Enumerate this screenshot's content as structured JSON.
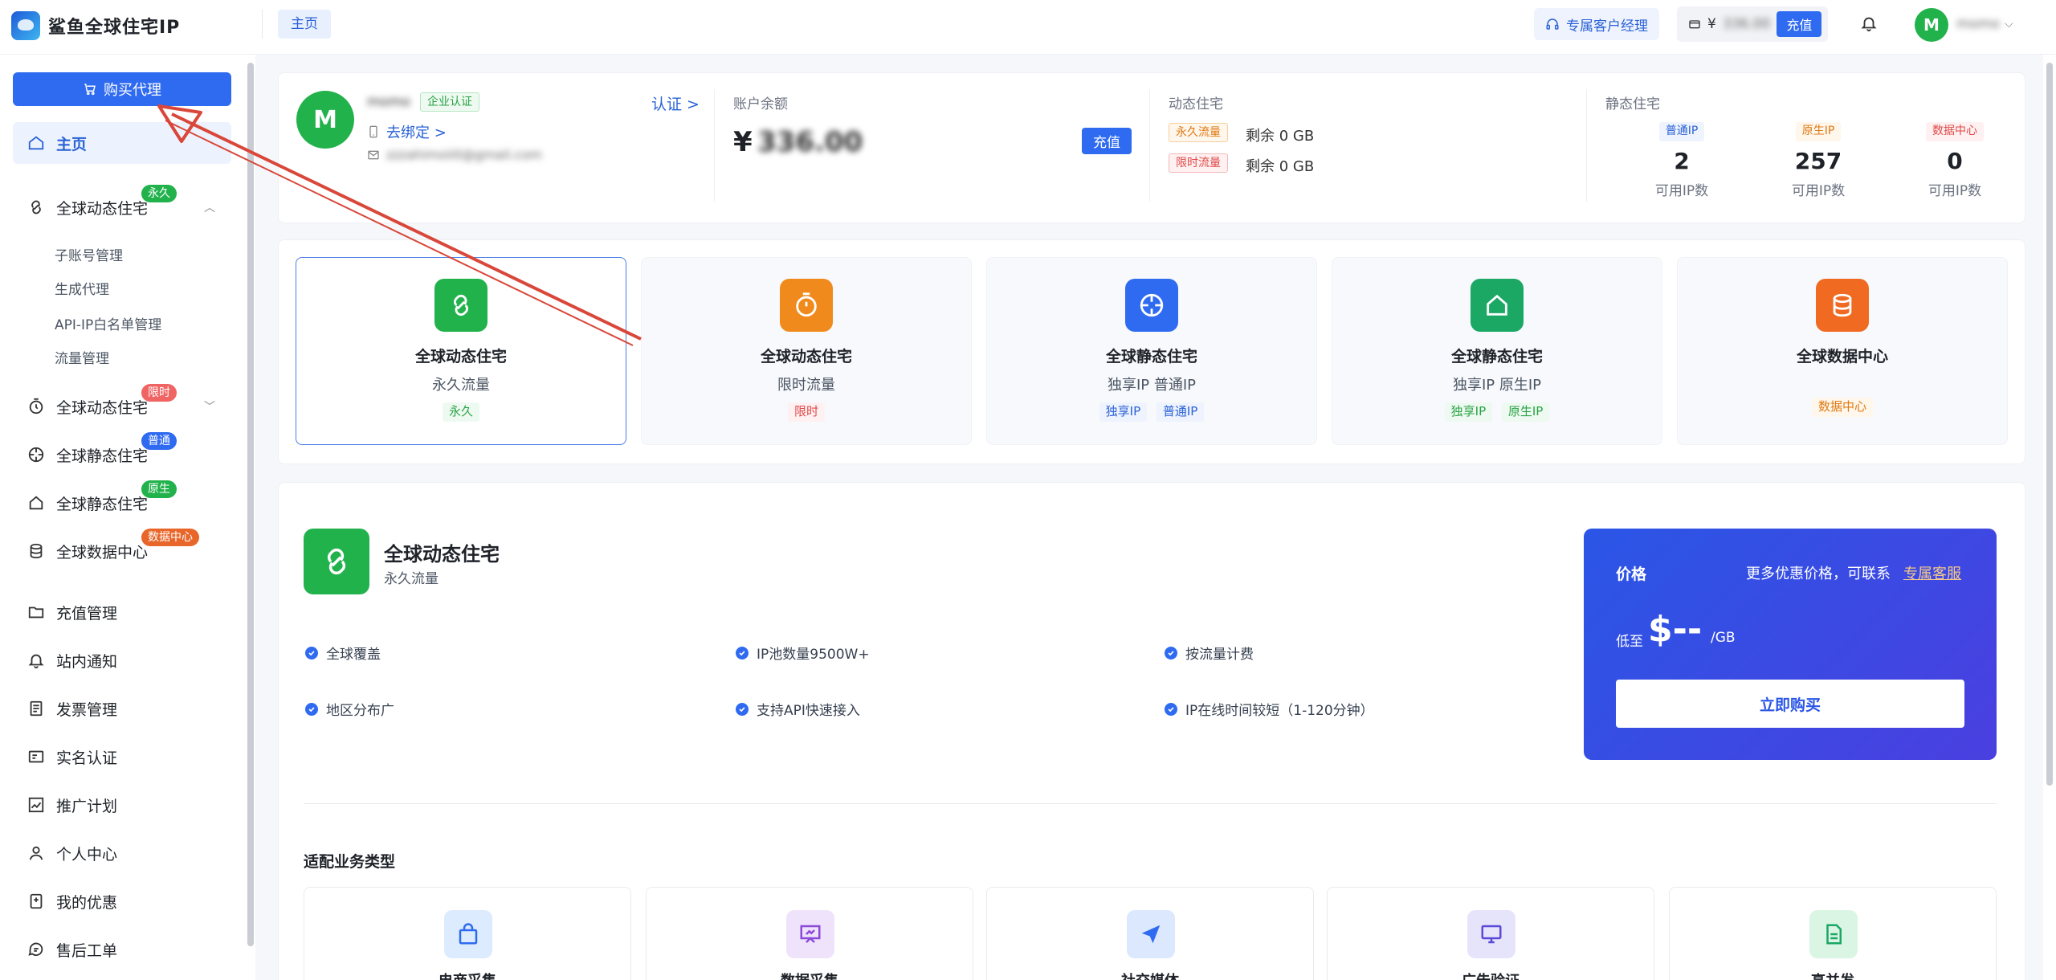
{
  "app": {
    "title": "鲨鱼全球住宅IP"
  },
  "topbar": {
    "tab_home": "主页",
    "manager_label": "专属客户经理",
    "currency": "¥",
    "balance_masked": "336.00",
    "recharge_label": "充值",
    "avatar_letter": "M",
    "user_name": "momo"
  },
  "sidebar": {
    "buy_label": "购买代理",
    "items": [
      {
        "label": "主页"
      },
      {
        "label": "全球动态住宅",
        "badge": "永久"
      },
      {
        "label": "子账号管理"
      },
      {
        "label": "生成代理"
      },
      {
        "label": "API-IP白名单管理"
      },
      {
        "label": "流量管理"
      },
      {
        "label": "全球动态住宅",
        "badge": "限时"
      },
      {
        "label": "全球静态住宅",
        "badge": "普通"
      },
      {
        "label": "全球静态住宅",
        "badge": "原生"
      },
      {
        "label": "全球数据中心",
        "badge": "数据中心"
      },
      {
        "label": "充值管理"
      },
      {
        "label": "站内通知"
      },
      {
        "label": "发票管理"
      },
      {
        "label": "实名认证"
      },
      {
        "label": "推广计划"
      },
      {
        "label": "个人中心"
      },
      {
        "label": "我的优惠"
      },
      {
        "label": "售后工单"
      }
    ]
  },
  "account": {
    "avatar_letter": "M",
    "name_masked": "momo",
    "enterprise_tag": "企业认证",
    "bind_label": "去绑定 >",
    "email_masked": "zzzahimoii0@gmail.com",
    "verify_label": "认证 >",
    "balance_label": "账户余额",
    "currency": "¥",
    "balance_masked": "336.00",
    "recharge_label": "充值",
    "dynamic_title": "动态住宅",
    "dynamic_rows": [
      {
        "tag": "永久流量",
        "text": "剩余 0 GB"
      },
      {
        "tag": "限时流量",
        "text": "剩余 0 GB"
      }
    ],
    "static_title": "静态住宅",
    "static_stats": [
      {
        "tag": "普通IP",
        "value": "2",
        "caption": "可用IP数"
      },
      {
        "tag": "原生IP",
        "value": "257",
        "caption": "可用IP数"
      },
      {
        "tag": "数据中心",
        "value": "0",
        "caption": "可用IP数"
      }
    ]
  },
  "products": [
    {
      "title": "全球动态住宅",
      "subtitle": "永久流量",
      "tags": [
        "永久"
      ]
    },
    {
      "title": "全球动态住宅",
      "subtitle": "限时流量",
      "tags": [
        "限时"
      ]
    },
    {
      "title": "全球静态住宅",
      "subtitle": "独享IP 普通IP",
      "tags": [
        "独享IP",
        "普通IP"
      ]
    },
    {
      "title": "全球静态住宅",
      "subtitle": "独享IP 原生IP",
      "tags": [
        "独享IP",
        "原生IP"
      ]
    },
    {
      "title": "全球数据中心",
      "subtitle": "",
      "tags": [
        "数据中心"
      ]
    }
  ],
  "detail": {
    "title": "全球动态住宅",
    "subtitle": "永久流量",
    "features": [
      "全球覆盖",
      "IP池数量9500W+",
      "按流量计费",
      "地区分布广",
      "支持API快速接入",
      "IP在线时间较短（1-120分钟）"
    ],
    "price_label": "价格",
    "price_contact": "更多优惠价格，可联系",
    "price_contact_link": "专属客服",
    "price_prefix": "低至",
    "price_value": "$--",
    "price_unit": "/GB",
    "buy_now_label": "立即购买"
  },
  "business": {
    "title": "适配业务类型",
    "items": [
      "电商采集",
      "数据采集",
      "社交媒体",
      "广告验证",
      "高并发"
    ]
  },
  "colors": {
    "primary": "#2f6bf0",
    "green": "#22b24c",
    "orange": "#f08a1c",
    "red": "#e04848",
    "annotation": "#d9473a"
  }
}
